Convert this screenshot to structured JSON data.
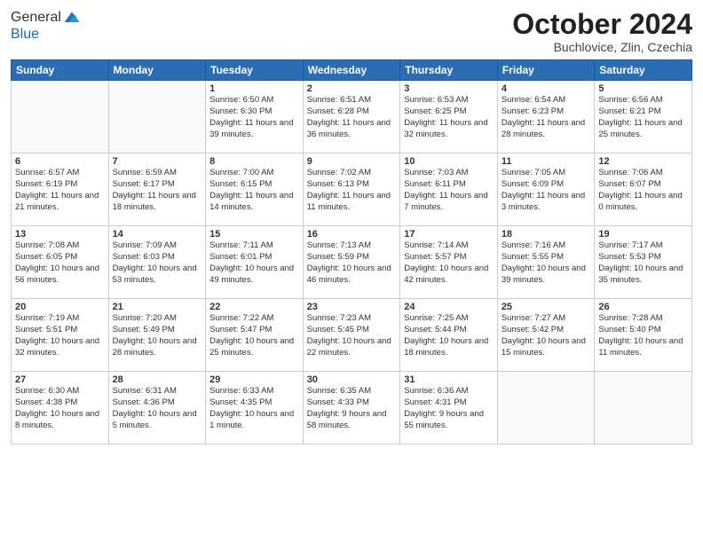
{
  "header": {
    "logo_line1": "General",
    "logo_line2": "Blue",
    "month": "October 2024",
    "location": "Buchlovice, Zlin, Czechia"
  },
  "days_of_week": [
    "Sunday",
    "Monday",
    "Tuesday",
    "Wednesday",
    "Thursday",
    "Friday",
    "Saturday"
  ],
  "weeks": [
    [
      {
        "day": "",
        "info": ""
      },
      {
        "day": "",
        "info": ""
      },
      {
        "day": "1",
        "info": "Sunrise: 6:50 AM\nSunset: 6:30 PM\nDaylight: 11 hours and 39 minutes."
      },
      {
        "day": "2",
        "info": "Sunrise: 6:51 AM\nSunset: 6:28 PM\nDaylight: 11 hours and 36 minutes."
      },
      {
        "day": "3",
        "info": "Sunrise: 6:53 AM\nSunset: 6:25 PM\nDaylight: 11 hours and 32 minutes."
      },
      {
        "day": "4",
        "info": "Sunrise: 6:54 AM\nSunset: 6:23 PM\nDaylight: 11 hours and 28 minutes."
      },
      {
        "day": "5",
        "info": "Sunrise: 6:56 AM\nSunset: 6:21 PM\nDaylight: 11 hours and 25 minutes."
      }
    ],
    [
      {
        "day": "6",
        "info": "Sunrise: 6:57 AM\nSunset: 6:19 PM\nDaylight: 11 hours and 21 minutes."
      },
      {
        "day": "7",
        "info": "Sunrise: 6:59 AM\nSunset: 6:17 PM\nDaylight: 11 hours and 18 minutes."
      },
      {
        "day": "8",
        "info": "Sunrise: 7:00 AM\nSunset: 6:15 PM\nDaylight: 11 hours and 14 minutes."
      },
      {
        "day": "9",
        "info": "Sunrise: 7:02 AM\nSunset: 6:13 PM\nDaylight: 11 hours and 11 minutes."
      },
      {
        "day": "10",
        "info": "Sunrise: 7:03 AM\nSunset: 6:11 PM\nDaylight: 11 hours and 7 minutes."
      },
      {
        "day": "11",
        "info": "Sunrise: 7:05 AM\nSunset: 6:09 PM\nDaylight: 11 hours and 3 minutes."
      },
      {
        "day": "12",
        "info": "Sunrise: 7:06 AM\nSunset: 6:07 PM\nDaylight: 11 hours and 0 minutes."
      }
    ],
    [
      {
        "day": "13",
        "info": "Sunrise: 7:08 AM\nSunset: 6:05 PM\nDaylight: 10 hours and 56 minutes."
      },
      {
        "day": "14",
        "info": "Sunrise: 7:09 AM\nSunset: 6:03 PM\nDaylight: 10 hours and 53 minutes."
      },
      {
        "day": "15",
        "info": "Sunrise: 7:11 AM\nSunset: 6:01 PM\nDaylight: 10 hours and 49 minutes."
      },
      {
        "day": "16",
        "info": "Sunrise: 7:13 AM\nSunset: 5:59 PM\nDaylight: 10 hours and 46 minutes."
      },
      {
        "day": "17",
        "info": "Sunrise: 7:14 AM\nSunset: 5:57 PM\nDaylight: 10 hours and 42 minutes."
      },
      {
        "day": "18",
        "info": "Sunrise: 7:16 AM\nSunset: 5:55 PM\nDaylight: 10 hours and 39 minutes."
      },
      {
        "day": "19",
        "info": "Sunrise: 7:17 AM\nSunset: 5:53 PM\nDaylight: 10 hours and 35 minutes."
      }
    ],
    [
      {
        "day": "20",
        "info": "Sunrise: 7:19 AM\nSunset: 5:51 PM\nDaylight: 10 hours and 32 minutes."
      },
      {
        "day": "21",
        "info": "Sunrise: 7:20 AM\nSunset: 5:49 PM\nDaylight: 10 hours and 28 minutes."
      },
      {
        "day": "22",
        "info": "Sunrise: 7:22 AM\nSunset: 5:47 PM\nDaylight: 10 hours and 25 minutes."
      },
      {
        "day": "23",
        "info": "Sunrise: 7:23 AM\nSunset: 5:45 PM\nDaylight: 10 hours and 22 minutes."
      },
      {
        "day": "24",
        "info": "Sunrise: 7:25 AM\nSunset: 5:44 PM\nDaylight: 10 hours and 18 minutes."
      },
      {
        "day": "25",
        "info": "Sunrise: 7:27 AM\nSunset: 5:42 PM\nDaylight: 10 hours and 15 minutes."
      },
      {
        "day": "26",
        "info": "Sunrise: 7:28 AM\nSunset: 5:40 PM\nDaylight: 10 hours and 11 minutes."
      }
    ],
    [
      {
        "day": "27",
        "info": "Sunrise: 6:30 AM\nSunset: 4:38 PM\nDaylight: 10 hours and 8 minutes."
      },
      {
        "day": "28",
        "info": "Sunrise: 6:31 AM\nSunset: 4:36 PM\nDaylight: 10 hours and 5 minutes."
      },
      {
        "day": "29",
        "info": "Sunrise: 6:33 AM\nSunset: 4:35 PM\nDaylight: 10 hours and 1 minute."
      },
      {
        "day": "30",
        "info": "Sunrise: 6:35 AM\nSunset: 4:33 PM\nDaylight: 9 hours and 58 minutes."
      },
      {
        "day": "31",
        "info": "Sunrise: 6:36 AM\nSunset: 4:31 PM\nDaylight: 9 hours and 55 minutes."
      },
      {
        "day": "",
        "info": ""
      },
      {
        "day": "",
        "info": ""
      }
    ]
  ]
}
